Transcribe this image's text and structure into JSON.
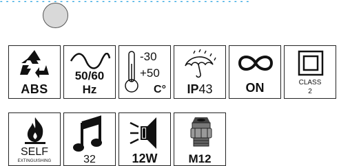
{
  "top_strip": "- - - - - - - - - - - - - - - - - - - - - - - - - - - - - - - - - - - - - - - - - -",
  "row1": {
    "abs": {
      "label": "ABS",
      "icon": "recycle-icon"
    },
    "frequency": {
      "line1": "50/60",
      "line2": "Hz",
      "icon": "sine-wave-icon"
    },
    "temperature": {
      "min": "-30",
      "max": "+50",
      "unit": "C°",
      "icon": "thermometer-icon"
    },
    "ip": {
      "prefix": "IP",
      "value": "43",
      "icon": "umbrella-rain-icon"
    },
    "continuous": {
      "label": "ON",
      "icon": "infinity-icon"
    },
    "class": {
      "line1": "CLASS",
      "line2": "2",
      "icon": "double-square-icon"
    }
  },
  "row2": {
    "self_ext": {
      "line1": "SELF",
      "line2": "EXTINGUISHING",
      "icon": "flame-icon"
    },
    "melodies": {
      "label": "32",
      "icon": "music-note-icon"
    },
    "power": {
      "label": "12W",
      "icon": "speaker-icon"
    },
    "gland": {
      "label": "M12",
      "icon": "cable-gland-icon"
    }
  },
  "colors": {
    "accent": "#2aa3e0",
    "circle_fill": "#d9d9d9",
    "border": "#222222"
  }
}
